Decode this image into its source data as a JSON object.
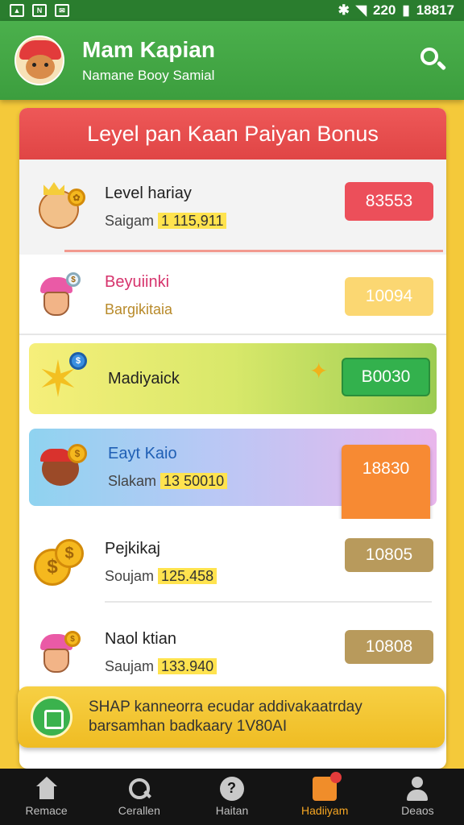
{
  "status_bar": {
    "time": "18817",
    "signal": "220"
  },
  "header": {
    "title": "Mam Kapian",
    "subtitle": "Namane Booy Samial"
  },
  "card": {
    "title": "Leyel pan Kaan Paiyan Bonus",
    "rows": [
      {
        "name": "Level hariay",
        "sub_label": "Saigam",
        "sub_value": "1 115,911",
        "badge": "83553"
      },
      {
        "name": "Beyuiinki",
        "sub_label": "Bargikitaia",
        "sub_value": "",
        "badge": "10094"
      },
      {
        "name": "Madiyaick",
        "sub_label": "",
        "sub_value": "",
        "badge": "B0030"
      },
      {
        "name": "Eayt Kaio",
        "sub_label": "Slakam",
        "sub_value": "13 50010",
        "badge": "18830"
      },
      {
        "name": "Pejkikaj",
        "sub_label": "Soujam",
        "sub_value": "125.458",
        "badge": "10805"
      },
      {
        "name": "Naol ktian",
        "sub_label": "Saujam",
        "sub_value": "133.940",
        "badge": "10808"
      }
    ]
  },
  "banner": {
    "line1": "SHAP kanneorra ecudar addivakaatrday",
    "line2": "barsamhan badkaary 1V80AI"
  },
  "nav": [
    {
      "label": "Remace"
    },
    {
      "label": "Cerallen"
    },
    {
      "label": "Haitan"
    },
    {
      "label": "Hadiiyam"
    },
    {
      "label": "Deaos"
    }
  ]
}
